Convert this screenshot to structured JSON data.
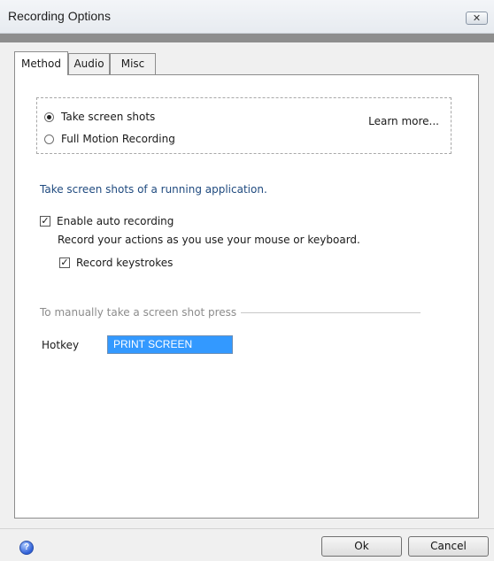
{
  "window": {
    "title": "Recording Options",
    "close_glyph": "✕"
  },
  "tabs": [
    {
      "label": "Method",
      "active": true
    },
    {
      "label": "Audio",
      "active": false
    },
    {
      "label": "Misc",
      "active": false
    }
  ],
  "method": {
    "options": [
      {
        "label": "Take screen shots",
        "selected": true
      },
      {
        "label": "Full Motion Recording",
        "selected": false
      }
    ],
    "learn_more": "Learn more...",
    "description": "Take screen shots of a running application.",
    "auto_recording": {
      "label": "Enable auto recording",
      "checked": true,
      "subtext": "Record your actions as you use your mouse or keyboard."
    },
    "keystrokes": {
      "label": "Record keystrokes",
      "checked": true
    },
    "manual_group_label": "To manually take a screen shot press",
    "hotkey_label": "Hotkey",
    "hotkey_value": "PRINT SCREEN"
  },
  "footer": {
    "help_icon": "help-icon",
    "help_glyph": "?",
    "ok_label": "Ok",
    "cancel_label": "Cancel"
  },
  "colors": {
    "accent": "#3399ff",
    "description_text": "#1f4a7f",
    "group_label": "#8c8c8c"
  }
}
